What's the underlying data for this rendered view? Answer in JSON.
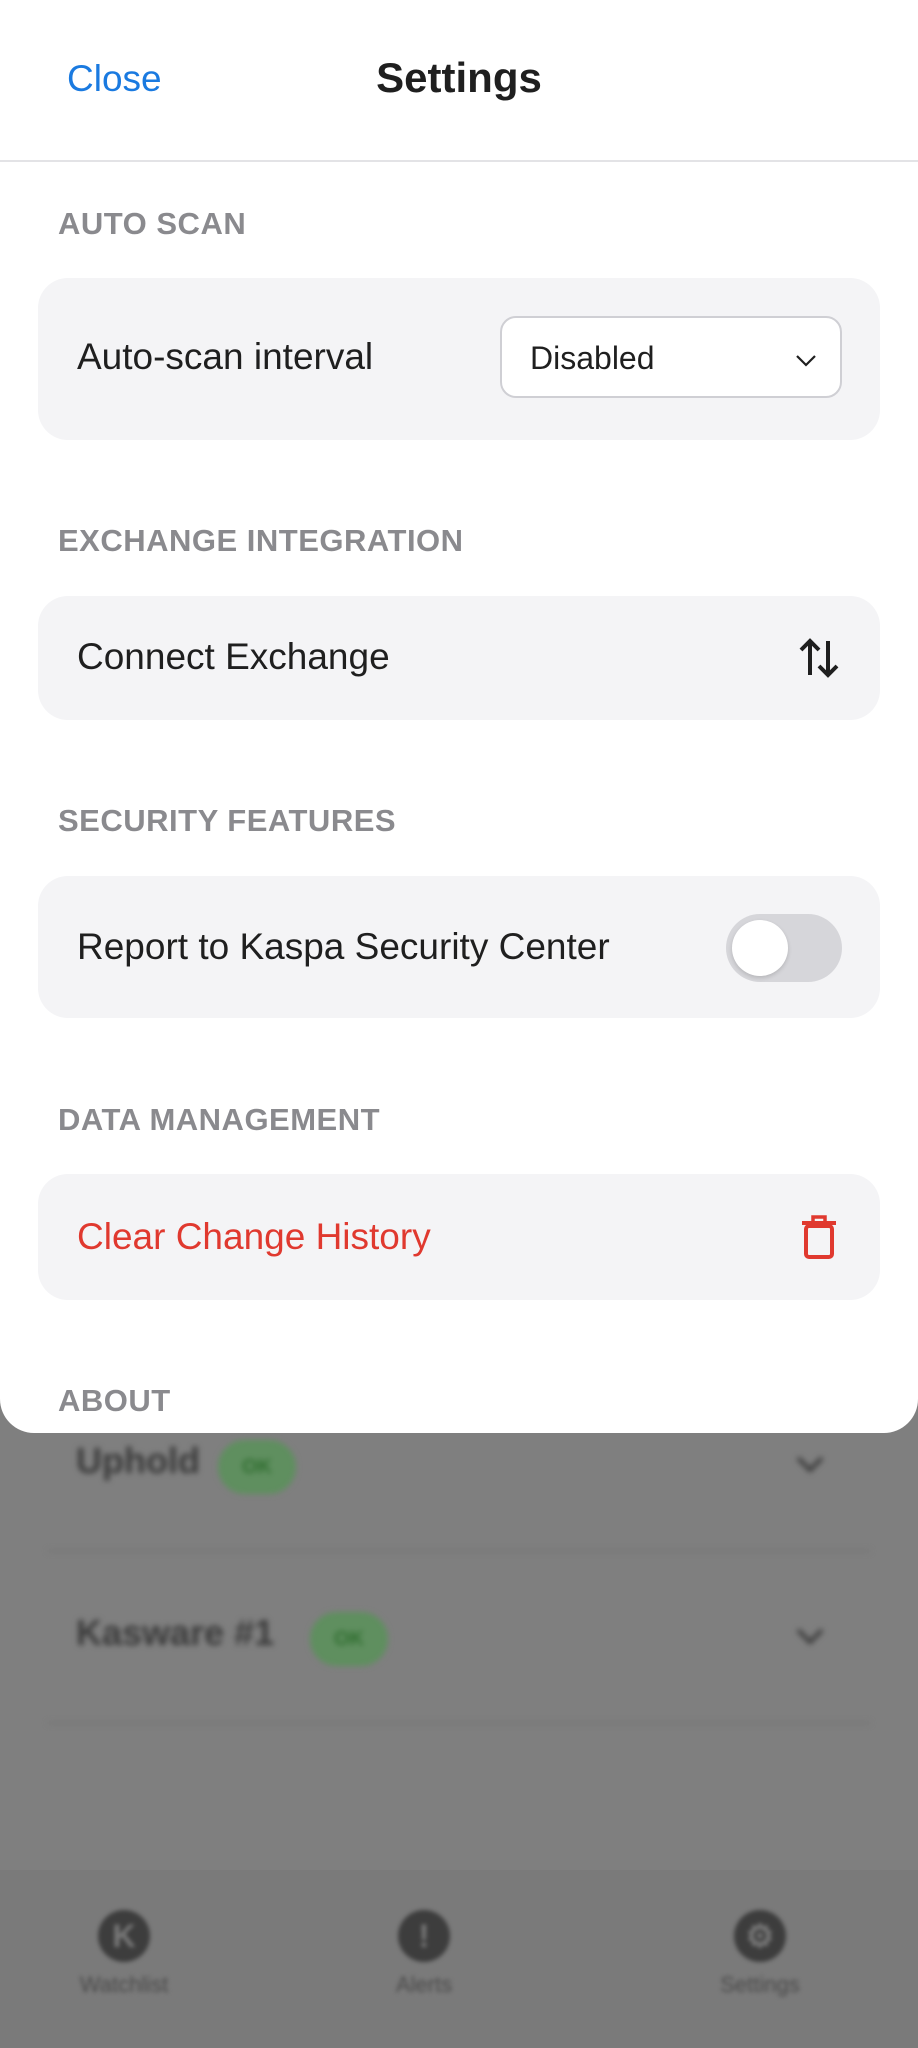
{
  "header": {
    "close_label": "Close",
    "title": "Settings"
  },
  "sections": {
    "auto_scan": {
      "label": "AUTO SCAN",
      "row_label": "Auto-scan interval",
      "select_value": "Disabled"
    },
    "exchange": {
      "label": "EXCHANGE INTEGRATION",
      "row_label": "Connect Exchange",
      "icon": "swap-arrows-icon"
    },
    "security": {
      "label": "SECURITY FEATURES",
      "row_label": "Report to Kaspa Security Center",
      "toggle_on": false
    },
    "data": {
      "label": "DATA MANAGEMENT",
      "row_label": "Clear Change History",
      "icon": "trash-icon",
      "danger_color": "#e0392f"
    },
    "about": {
      "label": "ABOUT"
    }
  },
  "background": {
    "wallets": [
      {
        "name": "Uphold",
        "status": "OK"
      },
      {
        "name": "Kasware #1",
        "status": "OK"
      }
    ],
    "tabs": [
      {
        "label": "Watchlist",
        "icon": "kaspa-logo-icon"
      },
      {
        "label": "Alerts",
        "icon": "alert-icon"
      },
      {
        "label": "Settings",
        "icon": "gear-icon"
      }
    ]
  },
  "colors": {
    "accent": "#1a7ae0",
    "danger": "#e0392f",
    "card_bg": "#f4f4f6"
  }
}
